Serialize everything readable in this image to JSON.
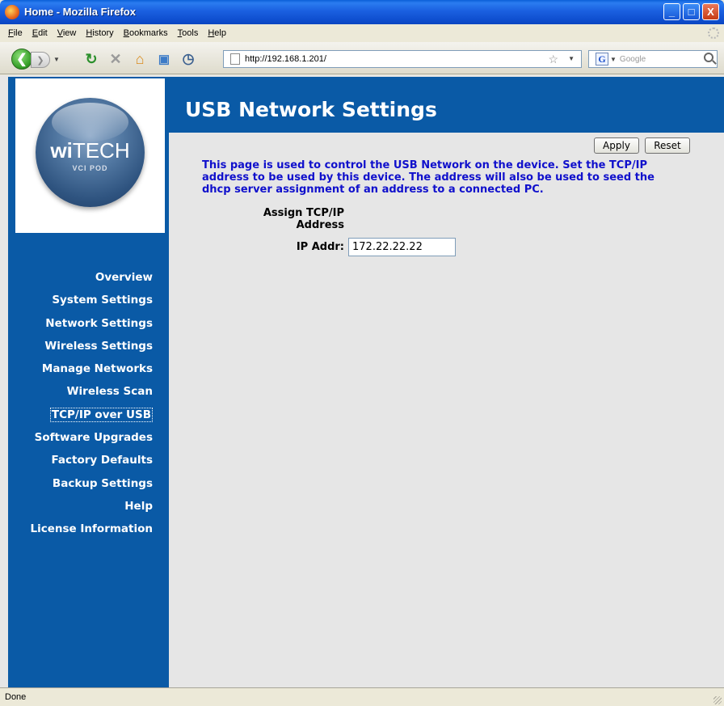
{
  "window": {
    "title": "Home - Mozilla Firefox",
    "controls": [
      "_",
      "□",
      "X"
    ]
  },
  "menu": [
    "File",
    "Edit",
    "View",
    "History",
    "Bookmarks",
    "Tools",
    "Help"
  ],
  "toolbar": {
    "url": "http://192.168.1.201/",
    "search_placeholder": "Google"
  },
  "logo": {
    "brand_prefix": "wi",
    "brand_suffix": "TECH",
    "subtitle": "VCI POD"
  },
  "sidebar": {
    "items": [
      {
        "label": "Overview"
      },
      {
        "label": "System Settings"
      },
      {
        "label": "Network Settings"
      },
      {
        "label": "Wireless Settings"
      },
      {
        "label": "Manage Networks"
      },
      {
        "label": "Wireless Scan"
      },
      {
        "label": "TCP/IP over USB",
        "active": true
      },
      {
        "label": "Software Upgrades"
      },
      {
        "label": "Factory Defaults"
      },
      {
        "label": "Backup Settings"
      },
      {
        "label": "Help"
      },
      {
        "label": "License Information"
      }
    ]
  },
  "page": {
    "title": "USB Network Settings",
    "apply_label": "Apply",
    "reset_label": "Reset",
    "description": "This page is used to control the USB Network on the device. Set the TCP/IP address to be used by this device. The address will also be used to seed the dhcp server assignment of an address to a connected PC.",
    "section_label_line1": "Assign TCP/IP",
    "section_label_line2": "Address",
    "ip_label": "IP Addr:",
    "ip_value": "172.22.22.22"
  },
  "status": {
    "text": "Done"
  },
  "colors": {
    "nav_blue": "#0a5aa6",
    "description_text": "#1010cc",
    "page_bg": "#e6e6e6"
  }
}
